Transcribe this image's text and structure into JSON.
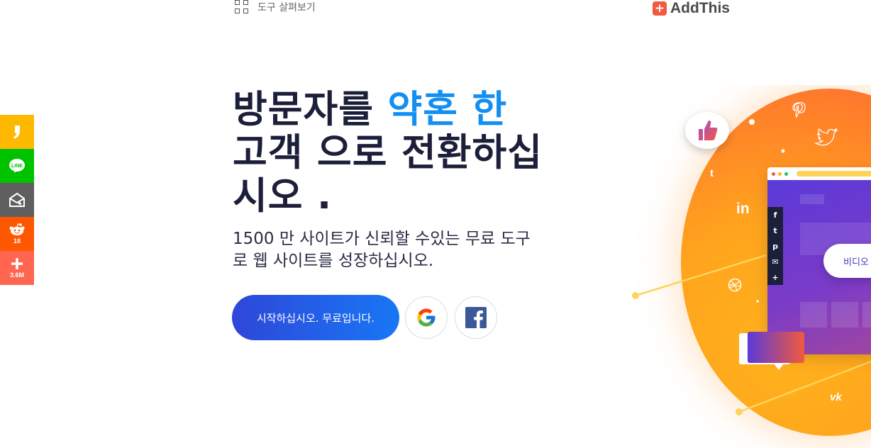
{
  "nav": {
    "tools_label": "도구 살펴보기",
    "brand_name": "AddThis",
    "brand_logo_glyph": "+"
  },
  "share_bar": [
    {
      "name": "kakaostory",
      "icon": "kakaostory-icon",
      "color": "#ffb800",
      "count": ""
    },
    {
      "name": "line",
      "icon": "line-icon",
      "color": "#00c300",
      "count": ""
    },
    {
      "name": "email",
      "icon": "email-envelope-icon",
      "color": "#5f5f5f",
      "count": ""
    },
    {
      "name": "reddit",
      "icon": "reddit-icon",
      "color": "#ff5700",
      "count": "18"
    },
    {
      "name": "more",
      "icon": "plus-icon",
      "color": "#ff6550",
      "count": "3.6M"
    }
  ],
  "hero": {
    "headline_part1": "방문자를 ",
    "headline_accent": "약혼 한",
    "headline_part2": "고객 으로 전환하십시오 .",
    "subheadline": "1500 만 사이트가 신뢰할 수있는 무료 도구로 웹 사이트를 성장하십시오.",
    "cta_label": "시작하십시오. 무료입니다.",
    "google_button": "google-icon",
    "facebook_button": "facebook-icon"
  },
  "illustration": {
    "video_pill_label": "비디오",
    "mini_share_glyphs": [
      "f",
      "t",
      "p",
      "✉",
      "+"
    ],
    "floating_icons": [
      "t",
      "in",
      "vk"
    ]
  },
  "colors": {
    "headline": "#1c1f3a",
    "accent": "#138ff2",
    "cta_start": "#2e47d9",
    "cta_end": "#1877f5",
    "blob": "#ffa41d"
  }
}
